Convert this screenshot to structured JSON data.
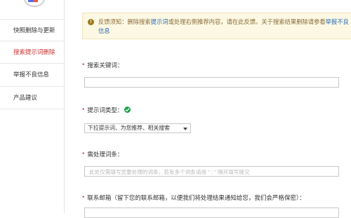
{
  "sidebar": {
    "items": [
      {
        "label": "快照删除与更新",
        "active": false
      },
      {
        "label": "搜索提示词删除",
        "active": true
      },
      {
        "label": "举报不良信息",
        "active": false
      },
      {
        "label": "产品建议",
        "active": false
      }
    ]
  },
  "notice": {
    "text1": "反馈须知：删除搜索",
    "link1": "提示词",
    "text2": "或处理右侧推荐内容，请在此反馈。关于搜索结果删除请参看",
    "link2": "举报不良信息"
  },
  "form": {
    "keyword_label": "搜索关键词：",
    "type_label": "提示词类型：",
    "type_value": "下拉提示词、为您推荐、相关搜索",
    "term_label": "需处理词条：",
    "term_placeholder": "此处仅需填写您要处理的词条，若有多个词条请用 \" ; \" 隔开填写提交",
    "email_label": "联系邮箱（留下您的联系邮箱，以便我们将处理结果通知给您，我们会严格保密）："
  },
  "colors": {
    "accent_red": "#c9302c",
    "link_blue": "#2a6db5",
    "notice_bg": "#fcf8e3",
    "check_green": "#1aa34a"
  }
}
